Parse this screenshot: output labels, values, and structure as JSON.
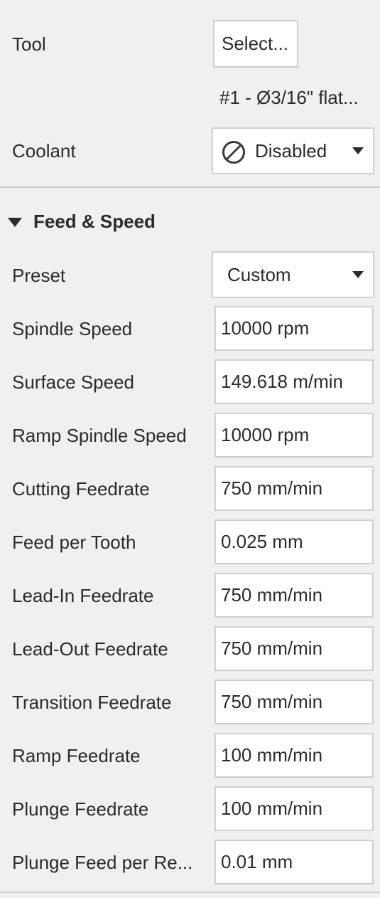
{
  "tool": {
    "label": "Tool",
    "select_button": "Select...",
    "selected_tool": "#1 - Ø3/16\" flat..."
  },
  "coolant": {
    "label": "Coolant",
    "value": "Disabled",
    "icon": "disabled-icon"
  },
  "feed_speed": {
    "title": "Feed & Speed",
    "expanded": true,
    "preset": {
      "label": "Preset",
      "value": "Custom"
    },
    "fields": [
      {
        "label": "Spindle Speed",
        "value": "10000 rpm"
      },
      {
        "label": "Surface Speed",
        "value": "149.618 m/min"
      },
      {
        "label": "Ramp Spindle Speed",
        "value": "10000 rpm"
      },
      {
        "label": "Cutting Feedrate",
        "value": "750 mm/min"
      },
      {
        "label": "Feed per Tooth",
        "value": "0.025 mm"
      },
      {
        "label": "Lead-In Feedrate",
        "value": "750 mm/min"
      },
      {
        "label": "Lead-Out Feedrate",
        "value": "750 mm/min"
      },
      {
        "label": "Transition Feedrate",
        "value": "750 mm/min"
      },
      {
        "label": "Ramp Feedrate",
        "value": "100 mm/min"
      },
      {
        "label": "Plunge Feedrate",
        "value": "100 mm/min"
      },
      {
        "label": "Plunge Feed per Re...",
        "value": "0.01 mm"
      }
    ]
  },
  "colors": {
    "background": "#f0f0f0",
    "field_border": "#cfcfcf",
    "text": "#2b2b2b"
  }
}
